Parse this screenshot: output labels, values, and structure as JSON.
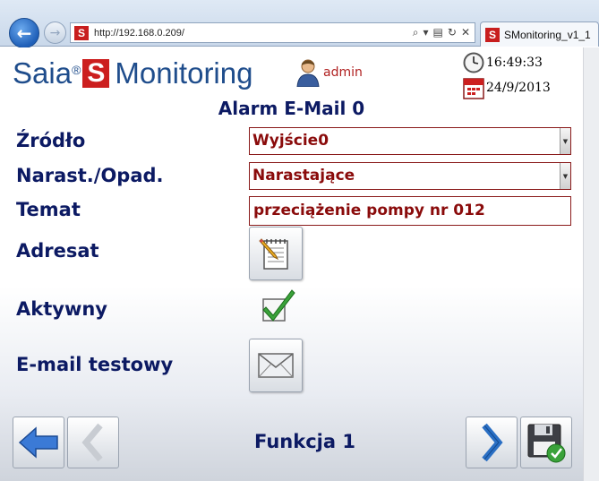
{
  "browser": {
    "url": "http://192.168.0.209/",
    "tab_title": "SMonitoring_v1_1",
    "favicon_letter": "S"
  },
  "header": {
    "logo_text_left": "Saia",
    "logo_registered": "®",
    "logo_s": "S",
    "logo_text_right": "Monitoring",
    "user": "admin",
    "time": "16:49:33",
    "date": "24/9/2013"
  },
  "page": {
    "title": "Alarm E-Mail 0"
  },
  "form": {
    "source_label": "Źródło",
    "source_value": "Wyjście0",
    "edge_label": "Narast./Opad.",
    "edge_value": "Narastające",
    "subject_label": "Temat",
    "subject_value": "przeciążenie pompy nr 012",
    "recipient_label": "Adresat",
    "active_label": "Aktywny",
    "test_email_label": "E-mail testowy"
  },
  "footer": {
    "function_label": "Funkcja 1"
  },
  "colors": {
    "label": "#0c1a63",
    "field_text": "#8a0b0b",
    "brand_blue": "#1f4d8c",
    "brand_red": "#cc1f1f"
  }
}
